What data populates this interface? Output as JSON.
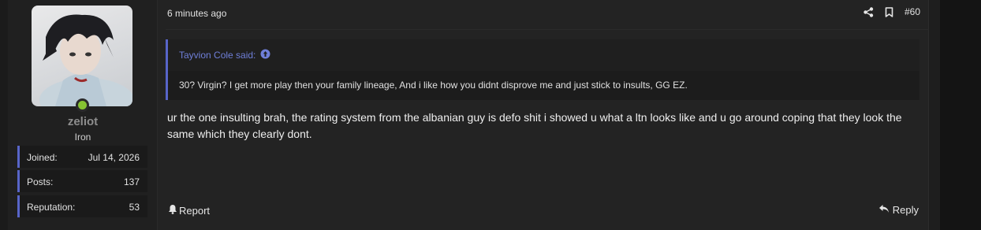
{
  "user": {
    "username": "zeliot",
    "title": "Iron",
    "stats": [
      {
        "label": "Joined:",
        "value": "Jul 14, 2026"
      },
      {
        "label": "Posts:",
        "value": "137"
      },
      {
        "label": "Reputation:",
        "value": "53"
      }
    ]
  },
  "post": {
    "time": "6 minutes ago",
    "number": "#60",
    "icons": [
      "share-icon",
      "bookmark-icon"
    ]
  },
  "quote": {
    "author_said": "Tayvion Cole said:",
    "text": "30? Virgin? I get more play then your family lineage, And i like how you didnt disprove me and just stick to insults, GG EZ."
  },
  "message": "ur the one insulting brah, the rating system from the albanian guy is defo shit i showed u what a ltn looks like and u go around coping that they look the same which they clearly dont.",
  "footer": {
    "report_label": "Report",
    "reply_label": "Reply"
  },
  "colors": {
    "accent": "#5865c9",
    "quote_author": "#6f7fd9",
    "online": "#86c232"
  }
}
